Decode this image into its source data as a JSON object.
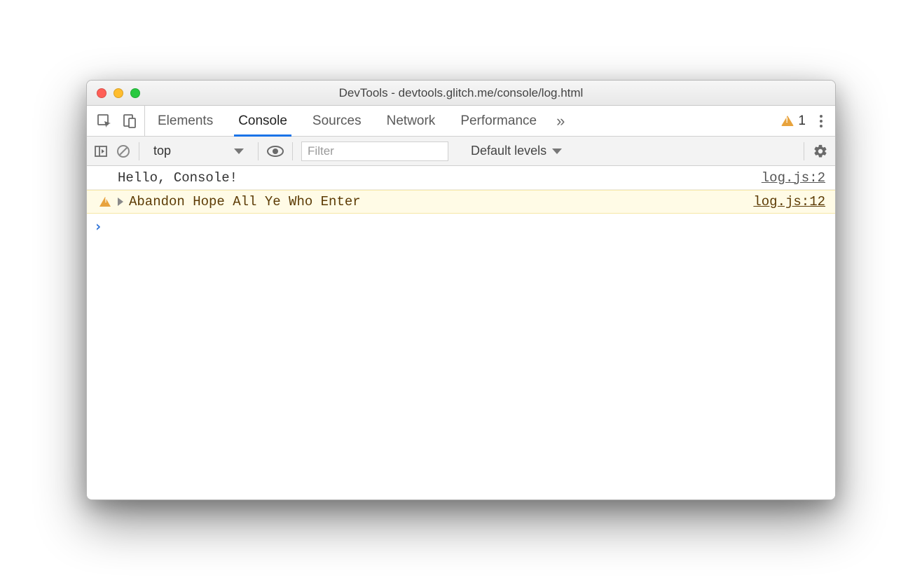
{
  "window": {
    "title": "DevTools - devtools.glitch.me/console/log.html"
  },
  "tabs": {
    "items": [
      "Elements",
      "Console",
      "Sources",
      "Network",
      "Performance"
    ],
    "active": "Console",
    "overflow_glyph": "»"
  },
  "warning_count": "1",
  "toolbar": {
    "context": "top",
    "filter_placeholder": "Filter",
    "levels_label": "Default levels"
  },
  "console": {
    "rows": [
      {
        "type": "log",
        "message": "Hello, Console!",
        "source": "log.js:2"
      },
      {
        "type": "warn",
        "message": "Abandon Hope All Ye Who Enter",
        "source": "log.js:12"
      }
    ],
    "prompt_glyph": "›"
  }
}
